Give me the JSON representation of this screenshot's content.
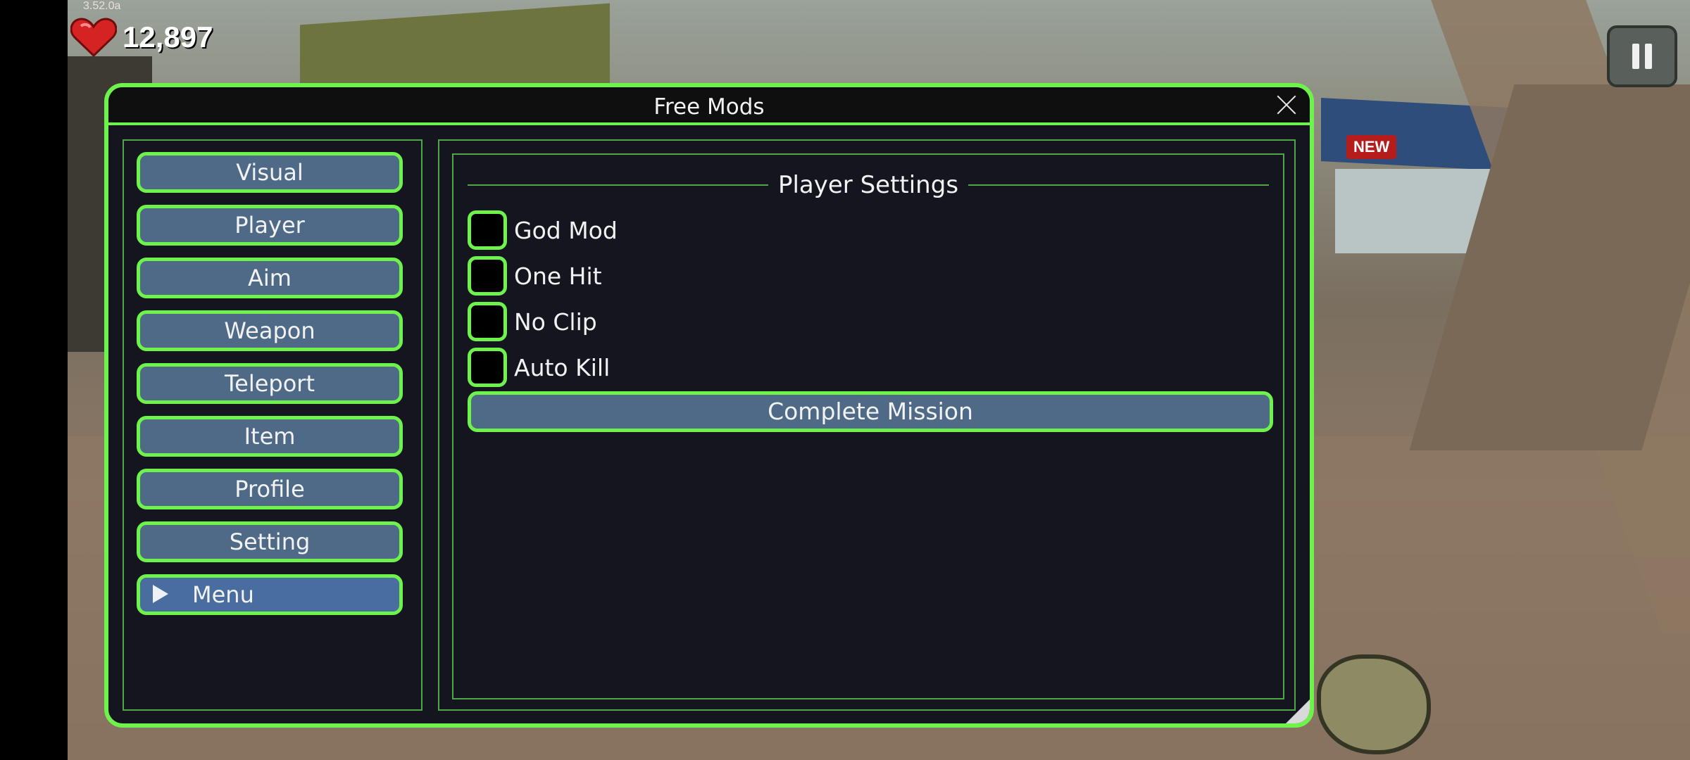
{
  "hud": {
    "version": "3.52.0a",
    "health": "12,897",
    "new_badge": "NEW"
  },
  "window": {
    "title": "Free Mods"
  },
  "sidebar": {
    "items": [
      {
        "label": "Visual"
      },
      {
        "label": "Player"
      },
      {
        "label": "Aim"
      },
      {
        "label": "Weapon"
      },
      {
        "label": "Teleport"
      },
      {
        "label": "Item"
      },
      {
        "label": "Profile"
      },
      {
        "label": "Setting"
      },
      {
        "label": "Menu"
      }
    ]
  },
  "content": {
    "section_title": "Player Settings",
    "toggles": [
      {
        "label": "God Mod",
        "checked": false
      },
      {
        "label": "One Hit",
        "checked": false
      },
      {
        "label": "No Clip",
        "checked": false
      },
      {
        "label": "Auto Kill",
        "checked": false
      }
    ],
    "action_button": "Complete Mission"
  },
  "colors": {
    "accent": "#6ef24c",
    "button": "#4e6a86",
    "panel": "#14151f"
  }
}
